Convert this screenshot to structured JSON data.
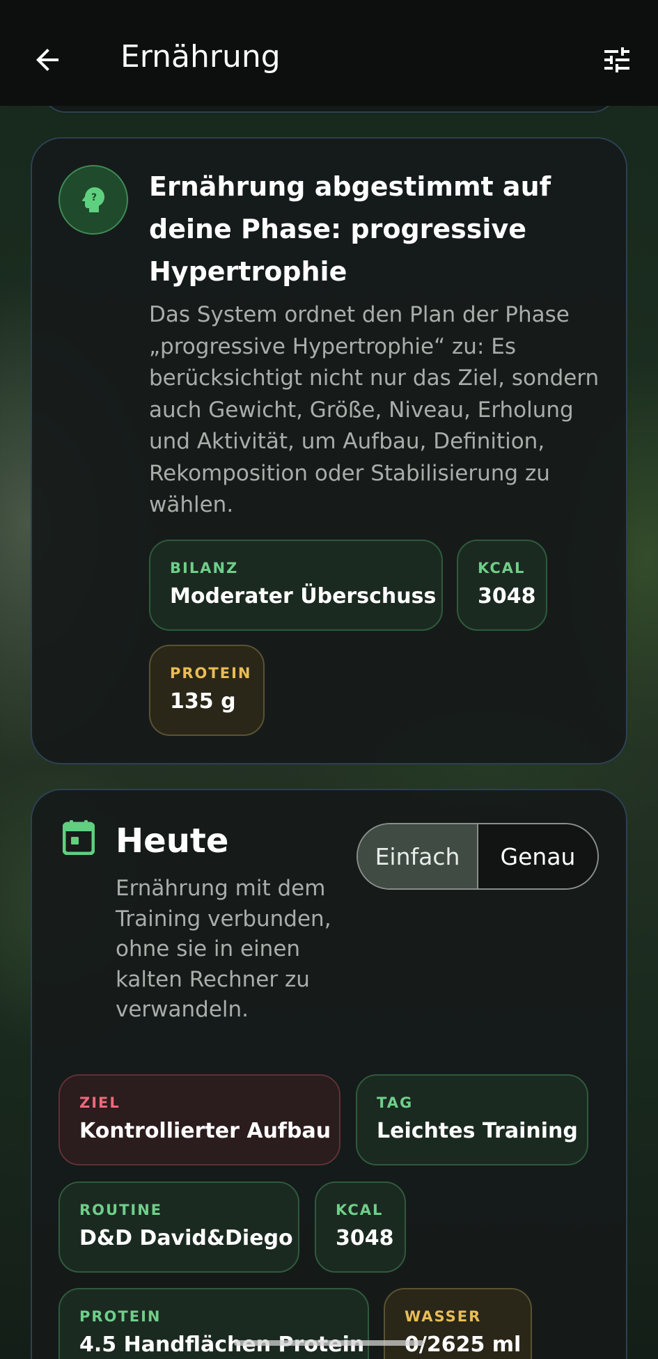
{
  "appbar": {
    "title": "Ernährung",
    "back_icon": "arrow-left-icon",
    "filter_icon": "tune-sliders-icon"
  },
  "phase_card": {
    "icon": "head-question-icon",
    "title": "Ernährung abgestimmt auf deine Phase: progressive Hypertrophie",
    "description": "Das System ordnet den Plan der Phase „progressive Hypertrophie“ zu: Es berücksichtigt nicht nur das Ziel, sondern auch Gewicht, Größe, Niveau, Erholung und Aktivität, um Aufbau, Definition, Rekomposition oder Stabilisierung zu wählen.",
    "chips": [
      {
        "label": "BILANZ",
        "value": "Moderater Überschuss"
      },
      {
        "label": "KCAL",
        "value": "3048"
      },
      {
        "label": "PROTEIN",
        "value": "135 g"
      }
    ]
  },
  "today_card": {
    "icon": "calendar-icon",
    "title": "Heute",
    "description": "Ernährung mit dem Training verbunden, ohne sie in einen kalten Rechner zu verwandeln.",
    "mode_toggle": {
      "options": [
        "Einfach",
        "Genau"
      ],
      "selected": "Einfach"
    },
    "chips": [
      {
        "label": "ZIEL",
        "value": "Kontrollierter Aufbau"
      },
      {
        "label": "TAG",
        "value": "Leichtes Training"
      },
      {
        "label": "ROUTINE",
        "value": "D&D David&Diego"
      },
      {
        "label": "KCAL",
        "value": "3048"
      },
      {
        "label": "PROTEIN",
        "value": "4.5 Handflächen Protein"
      },
      {
        "label": "WASSER",
        "value": "0/2625 ml"
      }
    ]
  },
  "colors": {
    "accent_green": "#6fcf8a",
    "accent_gold": "#e9bd56",
    "accent_red": "#ec6a7a",
    "card_border": "#2c4152"
  }
}
